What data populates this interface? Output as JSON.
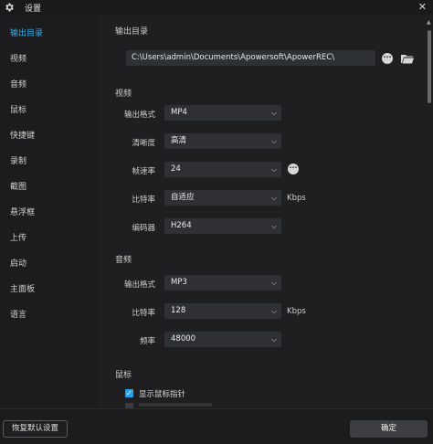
{
  "window": {
    "title": "设置",
    "close_glyph": "✕"
  },
  "sidebar": {
    "items": [
      {
        "label": "输出目录",
        "active": true
      },
      {
        "label": "视频"
      },
      {
        "label": "音频"
      },
      {
        "label": "鼠标"
      },
      {
        "label": "快捷键"
      },
      {
        "label": "录制"
      },
      {
        "label": "截图"
      },
      {
        "label": "悬浮框"
      },
      {
        "label": "上传"
      },
      {
        "label": "启动"
      },
      {
        "label": "主面板"
      },
      {
        "label": "语言"
      }
    ]
  },
  "output_dir": {
    "heading": "输出目录",
    "path": "C:\\Users\\admin\\Documents\\Apowersoft\\ApowerREC\\"
  },
  "video": {
    "heading": "视频",
    "format_label": "输出格式",
    "format_value": "MP4",
    "quality_label": "清晰度",
    "quality_value": "高清",
    "fps_label": "帧速率",
    "fps_value": "24",
    "bitrate_label": "比特率",
    "bitrate_value": "自适应",
    "bitrate_unit": "Kbps",
    "encoder_label": "编码器",
    "encoder_value": "H264"
  },
  "audio": {
    "heading": "音频",
    "format_label": "输出格式",
    "format_value": "MP3",
    "bitrate_label": "比特率",
    "bitrate_value": "128",
    "bitrate_unit": "Kbps",
    "frequency_label": "频率",
    "frequency_value": "48000"
  },
  "mouse": {
    "heading": "鼠标",
    "show_pointer_label": "显示鼠标指针",
    "show_pointer_checked": true
  },
  "footer": {
    "reset_label": "恢复默认设置",
    "ok_label": "确定"
  },
  "colors": {
    "accent": "#39b2f2",
    "checkbox": "#2aa0ec",
    "background": "#1f1f21"
  }
}
